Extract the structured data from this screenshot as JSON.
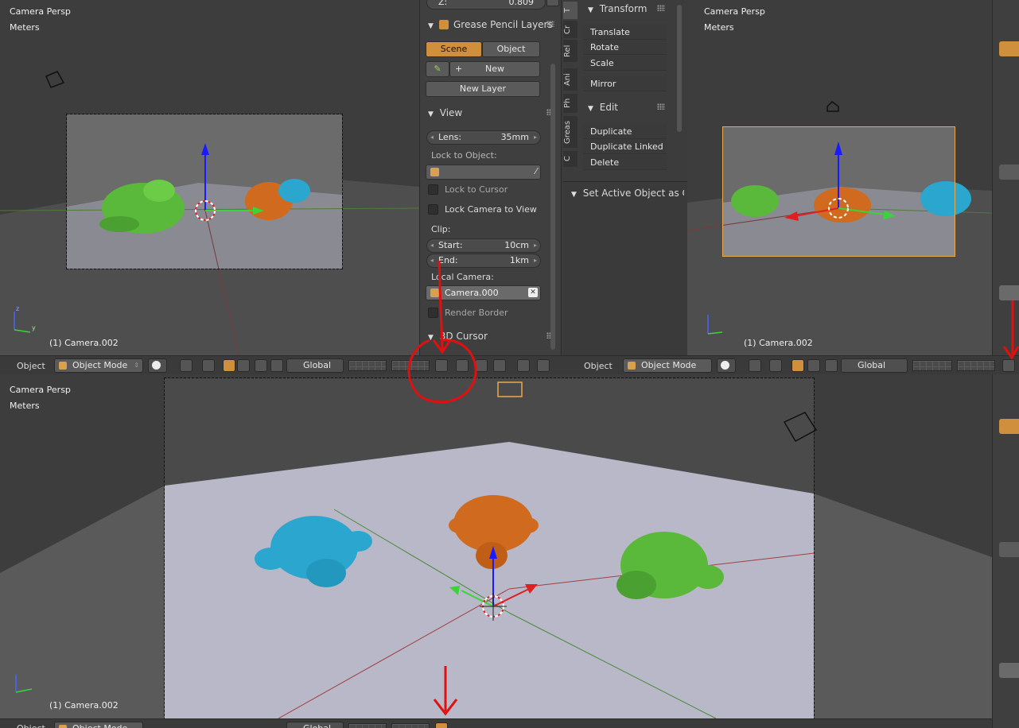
{
  "viewports": {
    "top_left": {
      "view_label": "Camera Persp",
      "units": "Meters",
      "object_label": "(1) Camera.002"
    },
    "top_right": {
      "view_label": "Camera Persp",
      "units": "Meters",
      "object_label": "(1) Camera.002"
    },
    "bottom": {
      "view_label": "Camera Persp",
      "units": "Meters",
      "object_label": "(1) Camera.002"
    }
  },
  "properties_panel": {
    "z_label": "Z:",
    "z_value": "0.809",
    "grease_pencil": {
      "title": "Grease Pencil Layers",
      "tab_scene": "Scene",
      "tab_object": "Object",
      "new_label": "New",
      "new_layer_label": "New Layer"
    },
    "view": {
      "title": "View",
      "lens_label": "Lens:",
      "lens_value": "35mm",
      "lock_to_object_label": "Lock to Object:",
      "lock_to_cursor_label": "Lock to Cursor",
      "lock_camera_label": "Lock Camera to View",
      "clip_label": "Clip:",
      "start_label": "Start:",
      "start_value": "10cm",
      "end_label": "End:",
      "end_value": "1km",
      "local_camera_label": "Local Camera:",
      "local_camera_value": "Camera.000",
      "render_border_label": "Render Border"
    },
    "cursor_title": "3D Cursor"
  },
  "tool_shelf": {
    "tabs": [
      "T",
      "Cr",
      "Rel",
      "Ani",
      "Ph",
      "Greas",
      "C"
    ],
    "transform_title": "Transform",
    "transform_items": [
      "Translate",
      "Rotate",
      "Scale",
      "Mirror"
    ],
    "edit_title": "Edit",
    "edit_items": [
      "Duplicate",
      "Duplicate Linked",
      "Delete"
    ],
    "operator_title": "Set Active Object as Ca"
  },
  "header": {
    "menu_object": "Object",
    "mode": "Object Mode",
    "orientation": "Global"
  },
  "colors": {
    "accent": "#d08f3c",
    "monkey_green": "#5ab83a",
    "monkey_orange": "#d06a1e",
    "monkey_blue": "#2aa6cf",
    "annotation_red": "#e01010"
  }
}
